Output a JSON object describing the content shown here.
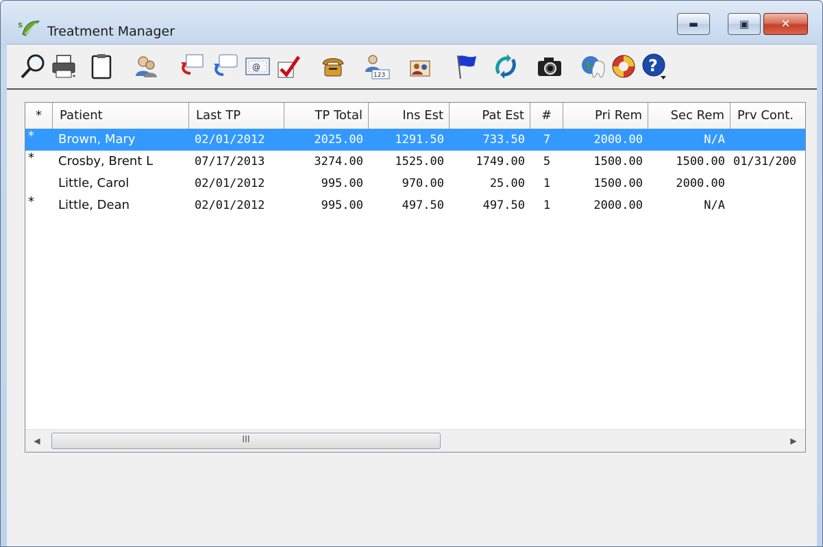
{
  "window": {
    "title": "Treatment Manager",
    "controls": {
      "minimize": "▬",
      "maximize": "▣",
      "close": "✕"
    }
  },
  "toolbar": {
    "icons": [
      "magnifier-icon",
      "printer-icon",
      "clipboard-icon",
      "patients-icon",
      "letter-icon",
      "message-icon",
      "email-icon",
      "checkmark-icon",
      "phone-icon",
      "patient-number-icon",
      "family-icon",
      "flag-icon",
      "refresh-icon",
      "camera-icon",
      "tooth-globe-icon",
      "lifesaver-icon",
      "help-icon"
    ]
  },
  "grid": {
    "columns": [
      {
        "key": "star",
        "label": "*"
      },
      {
        "key": "patient",
        "label": "Patient"
      },
      {
        "key": "last_tp",
        "label": "Last TP"
      },
      {
        "key": "tp_total",
        "label": "TP Total"
      },
      {
        "key": "ins_est",
        "label": "Ins Est"
      },
      {
        "key": "pat_est",
        "label": "Pat Est"
      },
      {
        "key": "num",
        "label": "#"
      },
      {
        "key": "pri_rem",
        "label": "Pri Rem"
      },
      {
        "key": "sec_rem",
        "label": "Sec Rem"
      },
      {
        "key": "prv_cont",
        "label": "Prv Cont."
      }
    ],
    "rows": [
      {
        "star": "*",
        "patient": "Brown, Mary",
        "last_tp": "02/01/2012",
        "tp_total": "2025.00",
        "ins_est": "1291.50",
        "pat_est": "733.50",
        "num": "7",
        "pri_rem": "2000.00",
        "sec_rem": "N/A",
        "prv_cont": "",
        "selected": true
      },
      {
        "star": "*",
        "patient": "Crosby, Brent L",
        "last_tp": "07/17/2013",
        "tp_total": "3274.00",
        "ins_est": "1525.00",
        "pat_est": "1749.00",
        "num": "5",
        "pri_rem": "1500.00",
        "sec_rem": "1500.00",
        "prv_cont": "01/31/200",
        "selected": false
      },
      {
        "star": "",
        "patient": "Little, Carol",
        "last_tp": "02/01/2012",
        "tp_total": "995.00",
        "ins_est": "970.00",
        "pat_est": "25.00",
        "num": "1",
        "pri_rem": "1500.00",
        "sec_rem": "2000.00",
        "prv_cont": "",
        "selected": false
      },
      {
        "star": "*",
        "patient": "Little, Dean",
        "last_tp": "02/01/2012",
        "tp_total": "995.00",
        "ins_est": "497.50",
        "pat_est": "497.50",
        "num": "1",
        "pri_rem": "2000.00",
        "sec_rem": "N/A",
        "prv_cont": "",
        "selected": false
      }
    ]
  },
  "scrollbar": {
    "left_arrow": "◀",
    "right_arrow": "▶",
    "grip": "III"
  }
}
